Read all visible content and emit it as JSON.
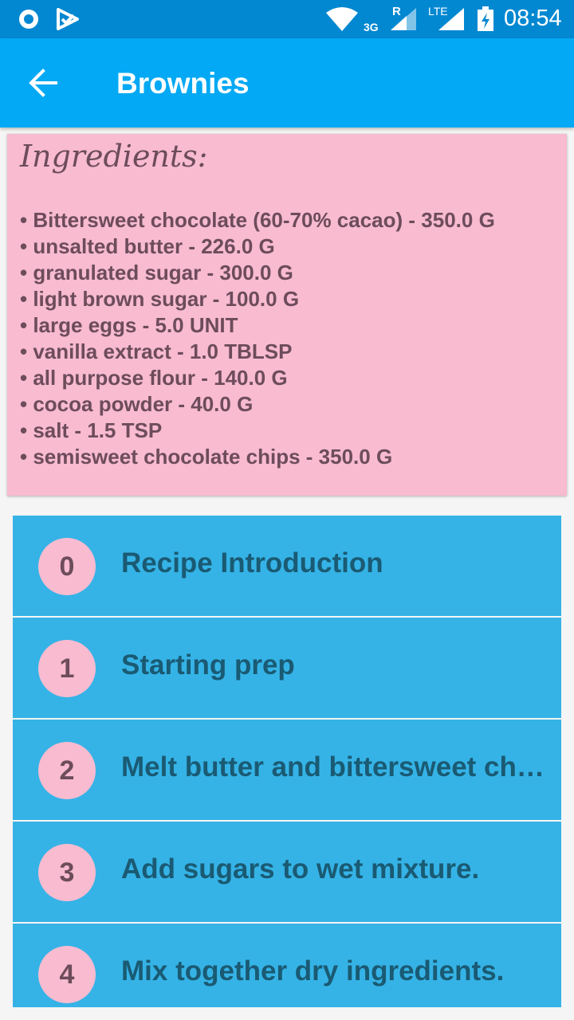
{
  "status_bar": {
    "network_3g": "3G",
    "roaming": "R",
    "lte": "LTE",
    "time": "08:54",
    "icons": [
      "circle-icon",
      "check-icon",
      "wifi-icon",
      "signal-icon",
      "signal-icon",
      "battery-icon"
    ]
  },
  "app_bar": {
    "title": "Brownies",
    "back_icon": "arrow-back-icon",
    "color": "#03a9f4"
  },
  "ingredients": {
    "heading": "Ingredients:",
    "items": [
      "• Bittersweet chocolate (60-70% cacao) - 350.0 G",
      "• unsalted butter - 226.0 G",
      "• granulated sugar - 300.0 G",
      "• light brown sugar - 100.0 G",
      "• large eggs - 5.0 UNIT",
      "• vanilla extract - 1.0 TBLSP",
      "• all purpose flour - 140.0 G",
      "• cocoa powder - 40.0 G",
      "• salt - 1.5 TSP",
      "• semisweet chocolate chips - 350.0 G"
    ],
    "color": "#f8bbd0"
  },
  "steps": [
    {
      "number": "0",
      "label": "Recipe Introduction"
    },
    {
      "number": "1",
      "label": "Starting prep"
    },
    {
      "number": "2",
      "label": "Melt butter and bittersweet chocolate."
    },
    {
      "number": "3",
      "label": "Add sugars to wet mixture."
    },
    {
      "number": "4",
      "label": "Mix together dry ingredients."
    }
  ],
  "colors": {
    "step_background": "#35b3e6",
    "step_text": "#1a5a73",
    "badge": "#f8bbd0"
  }
}
